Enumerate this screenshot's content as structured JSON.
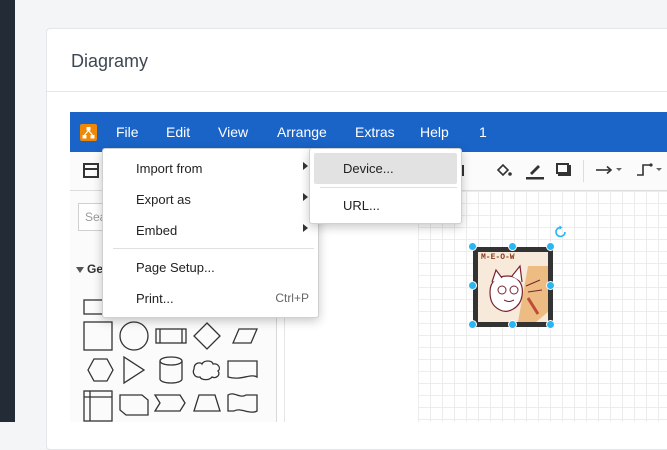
{
  "page": {
    "title": "Diagramy"
  },
  "menubar": {
    "items": [
      {
        "label": "File"
      },
      {
        "label": "Edit"
      },
      {
        "label": "View"
      },
      {
        "label": "Arrange"
      },
      {
        "label": "Extras"
      },
      {
        "label": "Help"
      },
      {
        "label": "1"
      }
    ]
  },
  "sidebar": {
    "search_placeholder": "Search",
    "search_visible": "Sea",
    "section_label": "Ge"
  },
  "file_menu": {
    "items": [
      {
        "label": "Import from",
        "has_submenu": true
      },
      {
        "label": "Export as",
        "has_submenu": true
      },
      {
        "label": "Embed",
        "has_submenu": true
      },
      {
        "label": "Page Setup..."
      },
      {
        "label": "Print...",
        "shortcut": "Ctrl+P"
      }
    ]
  },
  "import_submenu": {
    "items": [
      {
        "label": "Device..."
      },
      {
        "label": "URL..."
      }
    ]
  },
  "canvas": {
    "image_text": "M-E-O-W"
  },
  "colors": {
    "menubar": "#1a64c8",
    "accent_handles": "#29b6f2"
  }
}
